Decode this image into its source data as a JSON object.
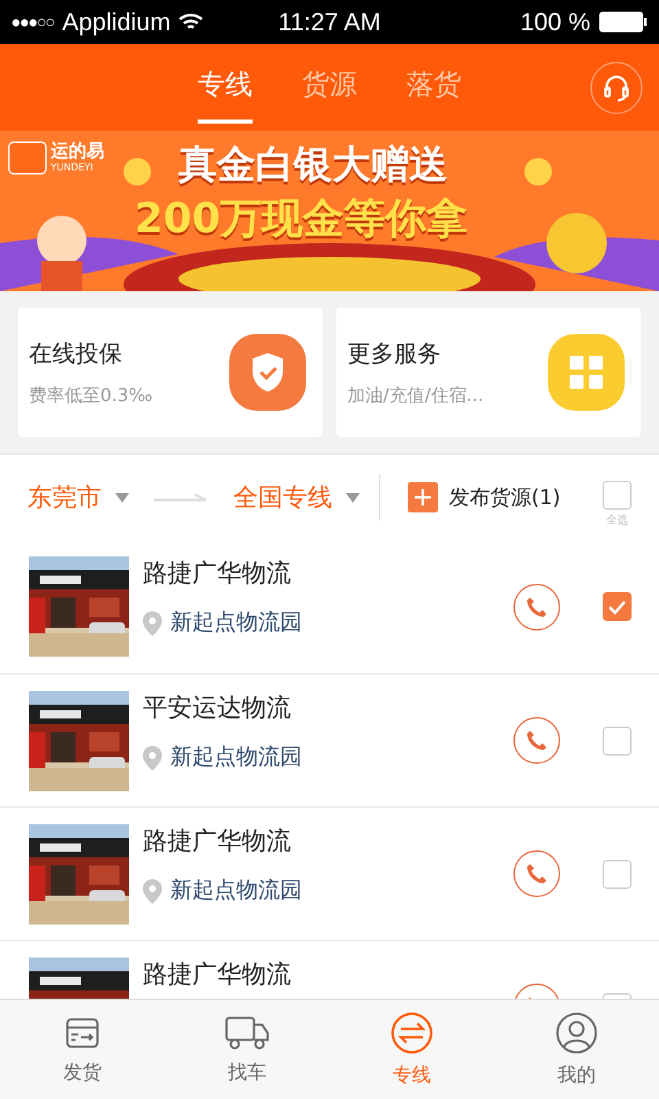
{
  "status_bar": {
    "signal": "●●●○○",
    "carrier": "Applidium",
    "time": "11:27 AM",
    "battery": "100 %"
  },
  "tabs": [
    {
      "label": "专线",
      "selected": true
    },
    {
      "label": "货源",
      "selected": false
    },
    {
      "label": "落货",
      "selected": false
    }
  ],
  "banner": {
    "logo": "运的易",
    "logo_sub": "YUNDEYI",
    "headline": "真金白银大赠送",
    "subline": "200万现金等你拿"
  },
  "services": [
    {
      "kind": "insurance",
      "title": "在线投保",
      "subtitle": "费率低至0.3‰"
    },
    {
      "kind": "more",
      "title": "更多服务",
      "subtitle": "加油/充值/住宿..."
    }
  ],
  "filter": {
    "origin": "东莞市",
    "destination": "全国专线",
    "publish": "发布货源(1)",
    "select_all": {
      "label": "全选",
      "checked": false
    }
  },
  "companies": [
    {
      "name": "路捷广华物流",
      "address": "新起点物流园",
      "checked": true
    },
    {
      "name": "平安运达物流",
      "address": "新起点物流园",
      "checked": false
    },
    {
      "name": "路捷广华物流",
      "address": "新起点物流园",
      "checked": false
    },
    {
      "name": "路捷广华物流",
      "checked": false
    }
  ],
  "bottom_nav": [
    {
      "kind": "ship",
      "label": "发货",
      "selected": false
    },
    {
      "kind": "truck",
      "label": "找车",
      "selected": false
    },
    {
      "kind": "line",
      "label": "专线",
      "selected": true
    },
    {
      "kind": "me",
      "label": "我的",
      "selected": false
    }
  ]
}
